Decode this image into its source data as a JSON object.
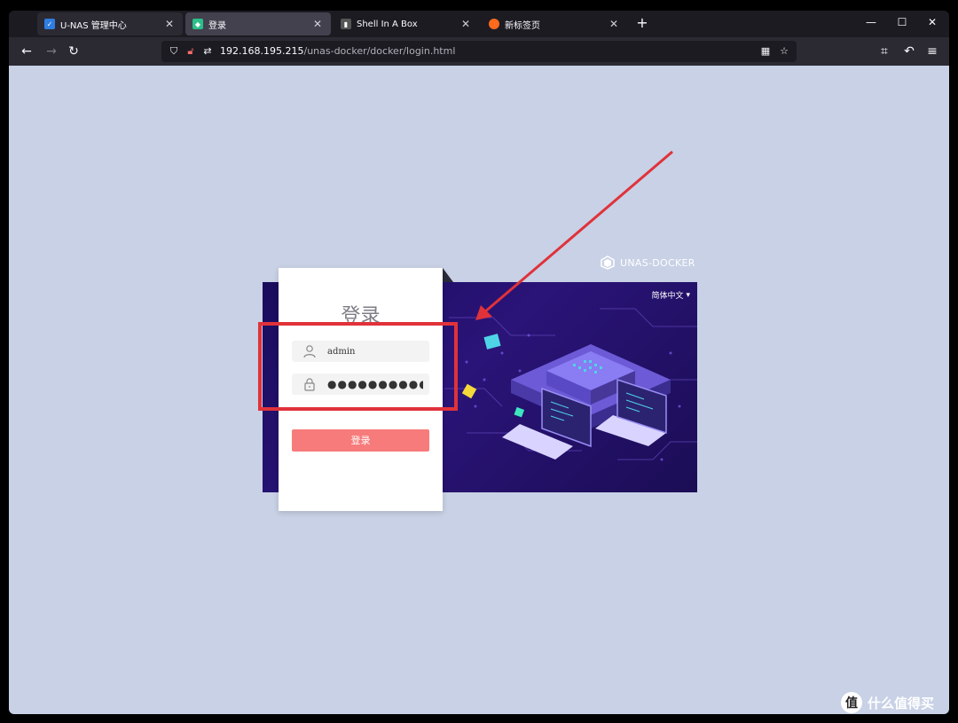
{
  "browser": {
    "tabs": [
      {
        "title": "U-NAS 管理中心",
        "favicon": "unas-icon",
        "state": "inactive"
      },
      {
        "title": "登录",
        "favicon": "docker-icon",
        "state": "active"
      },
      {
        "title": "Shell In A Box",
        "favicon": "shell-icon",
        "state": "plain"
      },
      {
        "title": "新标签页",
        "favicon": "firefox-icon",
        "state": "plain"
      }
    ],
    "url_host": "192.168.195.215",
    "url_path": "/unas-docker/docker/login.html"
  },
  "page": {
    "brand": "UNAS-DOCKER",
    "language": "简体中文",
    "login_title": "登录",
    "username_value": "admin",
    "password_value": "●●●●●●●●●●●",
    "login_button": "登录"
  },
  "annotation": {
    "highlight_color": "#e0323a"
  },
  "watermark": {
    "badge": "值",
    "text": "什么值得买"
  },
  "colors": {
    "page_bg": "#c8d1e5",
    "login_button": "#f77b7b",
    "hero_bg": "#1a0c5c"
  }
}
